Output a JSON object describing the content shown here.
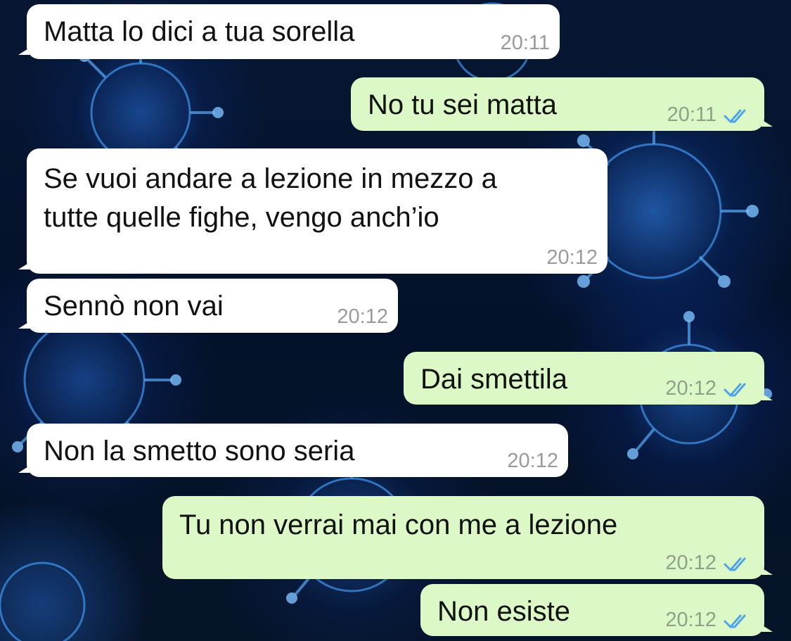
{
  "theme": {
    "incoming_bubble": "#ffffff",
    "outgoing_bubble": "#dcf8c6",
    "read_check_color": "#4fa3e8",
    "wallpaper": "dark blue coronavirus pattern"
  },
  "messages": [
    {
      "direction": "incoming",
      "text": "Matta lo dici a tua sorella",
      "time": "20:11"
    },
    {
      "direction": "outgoing",
      "text": "No tu sei matta",
      "time": "20:11",
      "status_icon": "double-check-icon"
    },
    {
      "direction": "incoming",
      "text": "Se vuoi andare a lezione in mezzo a\ntutte quelle fighe, vengo anch’io",
      "time": "20:12"
    },
    {
      "direction": "incoming",
      "text": "Sennò non vai",
      "time": "20:12"
    },
    {
      "direction": "outgoing",
      "text": "Dai smettila",
      "time": "20:12",
      "status_icon": "double-check-icon"
    },
    {
      "direction": "incoming",
      "text": "Non la smetto sono seria",
      "time": "20:12"
    },
    {
      "direction": "outgoing",
      "text": "Tu non verrai mai con me a lezione",
      "time": "20:12",
      "status_icon": "double-check-icon"
    },
    {
      "direction": "outgoing",
      "text": "Non esiste",
      "time": "20:12",
      "status_icon": "double-check-icon"
    }
  ]
}
